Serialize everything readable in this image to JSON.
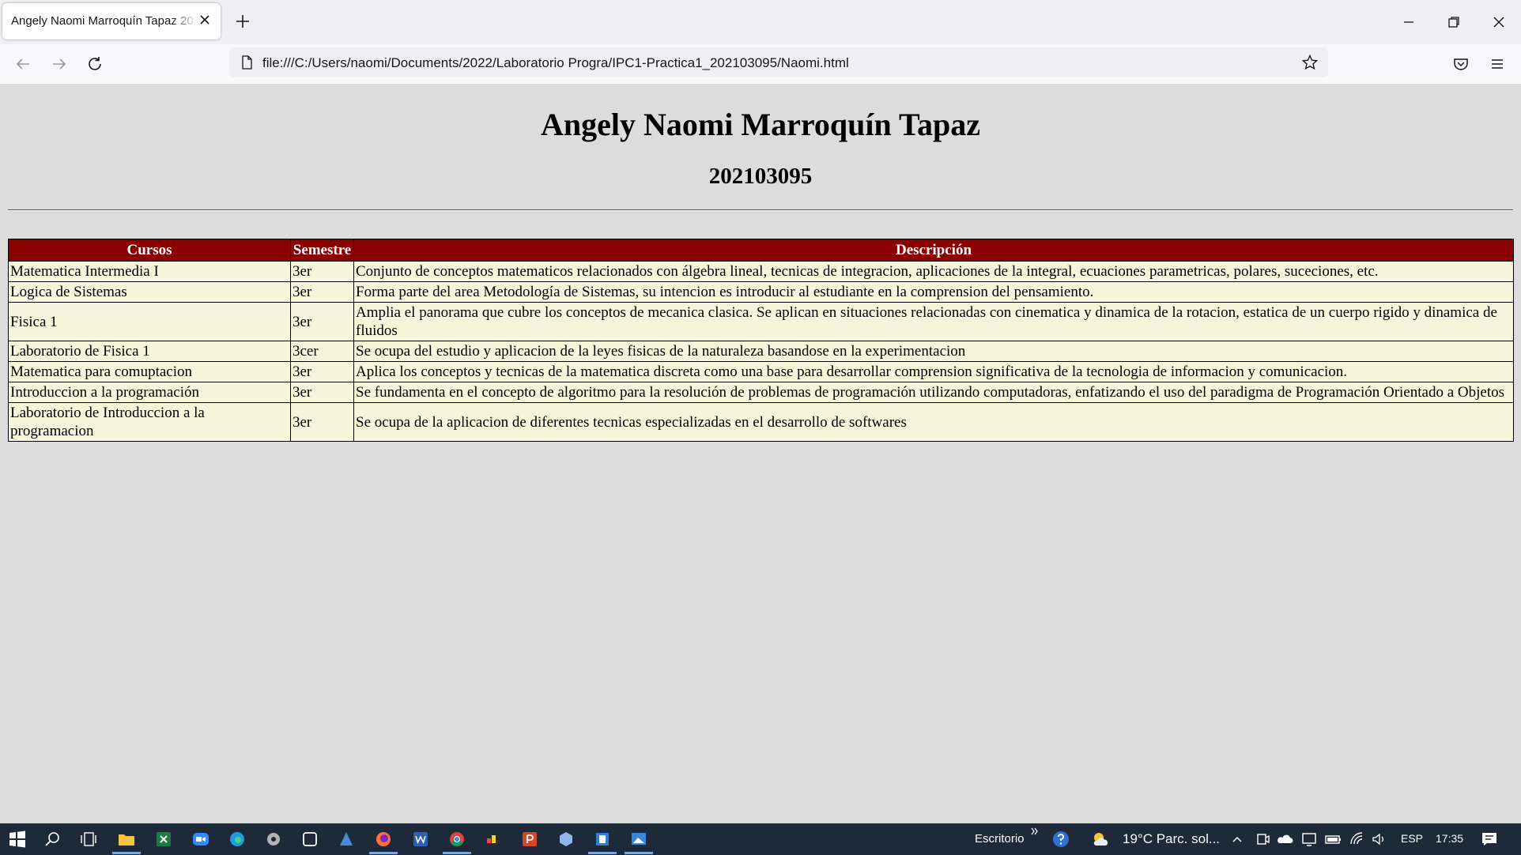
{
  "browser": {
    "tab_title": "Angely Naomi Marroquín Tapaz 202103095",
    "url": "file:///C:/Users/naomi/Documents/2022/Laboratorio Progra/IPC1-Practica1_202103095/Naomi.html"
  },
  "page": {
    "title": "Angely Naomi Marroquín Tapaz",
    "carnet": "202103095",
    "table": {
      "headers": [
        "Cursos",
        "Semestre",
        "Descripción"
      ],
      "rows": [
        [
          "Matematica Intermedia I",
          "3er",
          "Conjunto de conceptos matematicos relacionados con álgebra lineal, tecnicas de integracion, aplicaciones de la integral, ecuaciones parametricas, polares, suceciones, etc."
        ],
        [
          "Logica de Sistemas",
          "3er",
          "Forma parte del area Metodología de Sistemas, su intencion es introducir al estudiante en la comprension del pensamiento."
        ],
        [
          "Fisica 1",
          "3er",
          "Amplia el panorama que cubre los conceptos de mecanica clasica. Se aplican en situaciones relacionadas con cinematica y dinamica de la rotacion, estatica de un cuerpo rigido y dinamica de fluidos"
        ],
        [
          "Laboratorio de Fisica 1",
          "3cer",
          "Se ocupa del estudio y aplicacion de la leyes fisicas de la naturaleza basandose en la experimentacion"
        ],
        [
          "Matematica para comuptacion",
          "3er",
          "Aplica los conceptos y tecnicas de la matematica discreta como una base para desarrollar comprension significativa de la tecnologia de informacion y comunicacion."
        ],
        [
          "Introduccion a la programación",
          "3er",
          "Se fundamenta en el concepto de algoritmo para la resolución de problemas de programación utilizando computadoras, enfatizando el uso del paradigma de Programación Orientado a Objetos"
        ],
        [
          "Laboratorio de Introduccion a la programacion",
          "3er",
          "Se ocupa de la aplicacion de diferentes tecnicas especializadas en el desarrollo de softwares"
        ]
      ]
    }
  },
  "taskbar": {
    "desktop_label": "Escritorio",
    "weather": "19°C  Parc. sol...",
    "language": "ESP",
    "time": "17:35",
    "apps": [
      "start-icon",
      "search-icon",
      "task-view-icon",
      "file-explorer-icon",
      "excel-icon",
      "zoom-icon",
      "edge-icon",
      "app-icon",
      "app-icon-2",
      "app-icon-3",
      "firefox-icon",
      "word-icon",
      "chrome-icon",
      "app-icon-4",
      "powerpoint-icon",
      "app-icon-5",
      "app-icon-6",
      "app-icon-7"
    ]
  }
}
